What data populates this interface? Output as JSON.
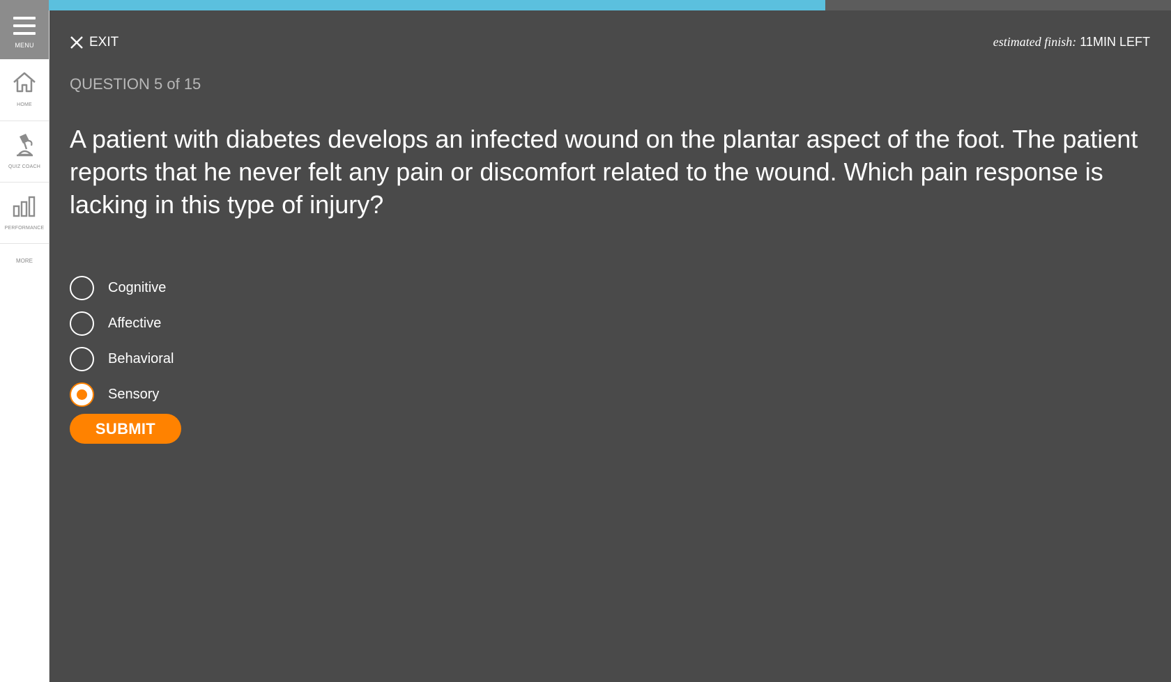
{
  "sidebar": {
    "menu_label": "MENU",
    "items": [
      {
        "label": "HOME",
        "icon": "home-icon"
      },
      {
        "label": "QUIZ COACH",
        "icon": "quiz-coach-icon"
      },
      {
        "label": "PERFORMANCE",
        "icon": "bar-chart-icon"
      }
    ],
    "more_label": "MORE"
  },
  "progress": {
    "fraction": 0.692,
    "fill_color": "#5bc0de",
    "track_color": "#5c5c5c"
  },
  "header": {
    "exit_label": "EXIT",
    "finish_label": "estimated finish:",
    "finish_value": " 11MIN LEFT"
  },
  "question": {
    "count_label": "QUESTION 5 of 15",
    "text": "A patient with diabetes develops an infected wound on the plantar aspect of the foot. The patient reports that he never felt any pain or discomfort related to the wound. Which pain response is lacking in this type of injury?"
  },
  "options": [
    {
      "label": "Cognitive",
      "selected": false
    },
    {
      "label": "Affective",
      "selected": false
    },
    {
      "label": "Behavioral",
      "selected": false
    },
    {
      "label": "Sensory",
      "selected": true
    }
  ],
  "submit_label": "SUBMIT",
  "colors": {
    "accent": "#ff8200",
    "background": "#4a4a4a",
    "sidebar": "#ffffff"
  }
}
